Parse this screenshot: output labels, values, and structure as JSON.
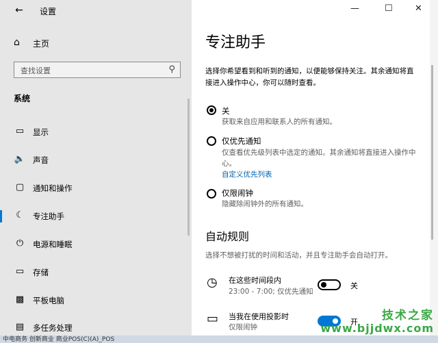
{
  "window": {
    "title": "设置"
  },
  "sidebar": {
    "home_label": "主页",
    "search_placeholder": "查找设置",
    "section": "系统",
    "items": [
      {
        "label": "显示",
        "icon": "monitor-icon"
      },
      {
        "label": "声音",
        "icon": "speaker-icon"
      },
      {
        "label": "通知和操作",
        "icon": "notification-icon"
      },
      {
        "label": "专注助手",
        "icon": "moon-icon"
      },
      {
        "label": "电源和睡眠",
        "icon": "power-icon"
      },
      {
        "label": "存储",
        "icon": "storage-icon"
      },
      {
        "label": "平板电脑",
        "icon": "tablet-icon"
      },
      {
        "label": "多任务处理",
        "icon": "multitask-icon"
      }
    ]
  },
  "main": {
    "title": "专注助手",
    "description": "选择你希望看到和听到的通知，以便能够保持关注。其余通知将直接进入操作中心，你可以随时查看。",
    "options": [
      {
        "title": "关",
        "desc": "获取来自应用和联系人的所有通知。",
        "selected": true
      },
      {
        "title": "仅优先通知",
        "desc": "仅查看优先级列表中选定的通知。其余通知将直接进入操作中心。",
        "link": "自定义优先列表",
        "selected": false
      },
      {
        "title": "仅限闹钟",
        "desc": "隐藏除闹钟外的所有通知。",
        "selected": false
      }
    ],
    "auto_rules": {
      "title": "自动规则",
      "description": "选择不想被打扰的时间和活动，并且专注助手会自动打开。",
      "rules": [
        {
          "title": "在这些时间段内",
          "subtitle": "23:00 - 7:00; 仅优先通知",
          "toggle": "关",
          "on": false,
          "icon": "clock-icon"
        },
        {
          "title": "当我在使用投影时",
          "subtitle": "仅限闹钟",
          "toggle": "开",
          "on": true,
          "icon": "monitor-icon"
        }
      ]
    }
  },
  "bottom_text": "中电商务  创新商业  商业POS(C)(A)_POS",
  "watermark": {
    "name": "技术之家",
    "url": "www.bjjdwx.com"
  },
  "colors": {
    "accent": "#0078d4",
    "sidebar_bg": "#e6e6e6",
    "link": "#0063b1",
    "watermark": "#3aa845"
  }
}
